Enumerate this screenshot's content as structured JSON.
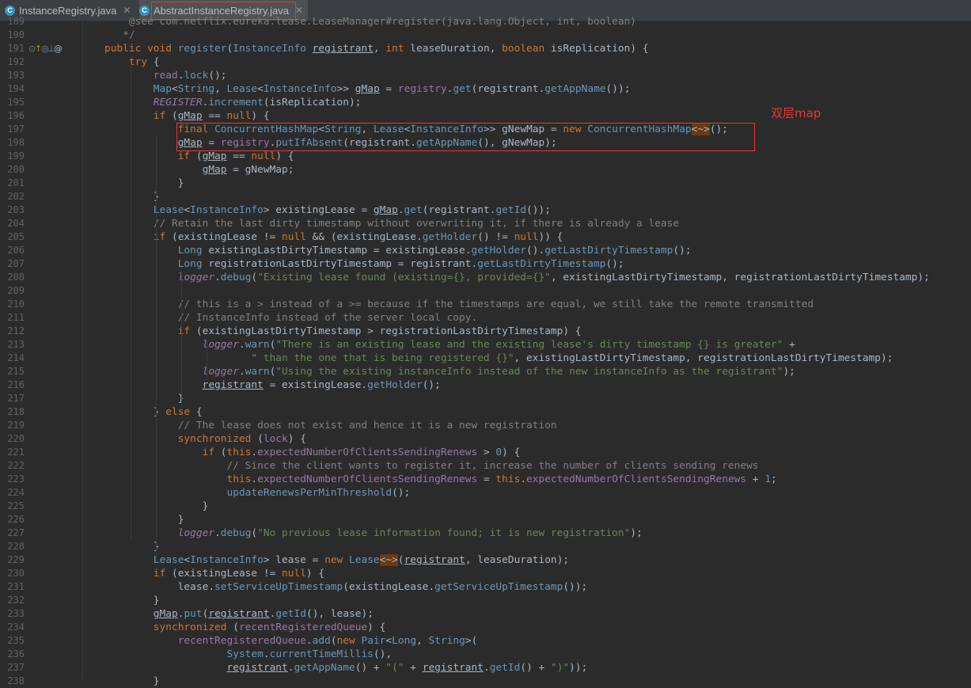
{
  "tabs": [
    {
      "name": "InstanceRegistry.java",
      "icon": "java-class-icon",
      "active": false
    },
    {
      "name": "AbstractInstanceRegistry.java",
      "icon": "java-class-icon",
      "active": true
    }
  ],
  "annotation": "双层map",
  "colors": {
    "keyword": "#cc7832",
    "string": "#6a8759",
    "comment": "#808080",
    "field": "#9876aa",
    "method": "#6897bb",
    "annotation_red": "#e53935"
  },
  "lines": [
    {
      "n": "189",
      "html": "    <span class=\"c\">@see com.netflix.eureka.lease.LeaseManager#register(java.lang.Object, int, boolean)</span>"
    },
    {
      "n": "190",
      "html": "   <span class=\"c\">*/</span>"
    },
    {
      "n": "191",
      "html": "<span class=\"k\">public void</span> <span class=\"mt\">register</span>(<span class=\"t\">InstanceInfo</span> <span class=\"u\">registrant</span>, <span class=\"k\">int</span> leaseDuration, <span class=\"k\">boolean</span> isReplication) {"
    },
    {
      "n": "192",
      "html": "    <span class=\"k\">try</span> {"
    },
    {
      "n": "193",
      "html": "        <span class=\"f\">read</span>.<span class=\"mt\">lock</span>();"
    },
    {
      "n": "194",
      "html": "        <span class=\"t\">Map</span>&lt;<span class=\"t\">String</span>, <span class=\"t\">Lease</span>&lt;<span class=\"t\">InstanceInfo</span>&gt;&gt; <span class=\"u\">gMap</span> = <span class=\"f\">registry</span>.<span class=\"mt\">get</span>(registrant.<span class=\"mt\">getAppName</span>());"
    },
    {
      "n": "195",
      "html": "        <span class=\"sf\">REGISTER</span>.<span class=\"mt\">increment</span>(isReplication);"
    },
    {
      "n": "196",
      "html": "        <span class=\"k\">if</span> (<span class=\"u\">gMap</span> == <span class=\"k\">null</span>) {"
    },
    {
      "n": "197",
      "html": "            <span class=\"k\">final</span> <span class=\"t\">ConcurrentHashMap</span>&lt;<span class=\"t\">String</span>, <span class=\"t\">Lease</span>&lt;<span class=\"t\">InstanceInfo</span>&gt;&gt; gNewMap = <span class=\"k\">new</span> <span class=\"t\">ConcurrentHashMap</span><span class=\"hl\">&lt;~&gt;</span>();"
    },
    {
      "n": "198",
      "html": "            <span class=\"u\">gMap</span> = <span class=\"f\">registry</span>.<span class=\"mt\">putIfAbsent</span>(registrant.<span class=\"mt\">getAppName</span>(), gNewMap);"
    },
    {
      "n": "199",
      "html": "            <span class=\"k\">if</span> (<span class=\"u\">gMap</span> == <span class=\"k\">null</span>) {"
    },
    {
      "n": "200",
      "html": "                <span class=\"u\">gMap</span> = gNewMap;"
    },
    {
      "n": "201",
      "html": "            }"
    },
    {
      "n": "202",
      "html": "        }"
    },
    {
      "n": "203",
      "html": "        <span class=\"t\">Lease</span>&lt;<span class=\"t\">InstanceInfo</span>&gt; existingLease = <span class=\"u\">gMap</span>.<span class=\"mt\">get</span>(registrant.<span class=\"mt\">getId</span>());"
    },
    {
      "n": "204",
      "html": "        <span class=\"c\">// Retain the last dirty timestamp without overwriting it, if there is already a lease</span>"
    },
    {
      "n": "205",
      "html": "        <span class=\"k\">if</span> (existingLease != <span class=\"k\">null</span> &amp;&amp; (existingLease.<span class=\"mt\">getHolder</span>() != <span class=\"k\">null</span>)) {"
    },
    {
      "n": "206",
      "html": "            <span class=\"t\">Long</span> existingLastDirtyTimestamp = existingLease.<span class=\"mt\">getHolder</span>().<span class=\"mt\">getLastDirtyTimestamp</span>();"
    },
    {
      "n": "207",
      "html": "            <span class=\"t\">Long</span> registrationLastDirtyTimestamp = registrant.<span class=\"mt\">getLastDirtyTimestamp</span>();"
    },
    {
      "n": "208",
      "html": "            <span class=\"sf\">logger</span>.<span class=\"mt\">debug</span>(<span class=\"s\">\"Existing lease found (existing={}, provided={}\"</span>, existingLastDirtyTimestamp, registrationLastDirtyTimestamp);"
    },
    {
      "n": "209",
      "html": ""
    },
    {
      "n": "210",
      "html": "            <span class=\"c\">// this is a &gt; instead of a &gt;= because if the timestamps are equal, we still take the remote transmitted</span>"
    },
    {
      "n": "211",
      "html": "            <span class=\"c\">// InstanceInfo instead of the server local copy.</span>"
    },
    {
      "n": "212",
      "html": "            <span class=\"k\">if</span> (existingLastDirtyTimestamp &gt; registrationLastDirtyTimestamp) {"
    },
    {
      "n": "213",
      "html": "                <span class=\"sf\">logger</span>.<span class=\"mt\">warn</span>(<span class=\"s\">\"There is an existing lease and the existing lease's dirty timestamp {} is greater\"</span> +"
    },
    {
      "n": "214",
      "html": "                        <span class=\"s\">\" than the one that is being registered {}\"</span>, existingLastDirtyTimestamp, registrationLastDirtyTimestamp);"
    },
    {
      "n": "215",
      "html": "                <span class=\"sf\">logger</span>.<span class=\"mt\">warn</span>(<span class=\"s\">\"Using the existing instanceInfo instead of the new instanceInfo as the registrant\"</span>);"
    },
    {
      "n": "216",
      "html": "                <span class=\"u\">registrant</span> = existingLease.<span class=\"mt\">getHolder</span>();"
    },
    {
      "n": "217",
      "html": "            }"
    },
    {
      "n": "218",
      "html": "        } <span class=\"k\">else</span> {"
    },
    {
      "n": "219",
      "html": "            <span class=\"c\">// The lease does not exist and hence it is a new registration</span>"
    },
    {
      "n": "220",
      "html": "            <span class=\"k\">synchronized</span> (<span class=\"f\">lock</span>) {"
    },
    {
      "n": "221",
      "html": "                <span class=\"k\">if</span> (<span class=\"k\">this</span>.<span class=\"f\">expectedNumberOfClientsSendingRenews</span> &gt; <span class=\"n\">0</span>) {"
    },
    {
      "n": "222",
      "html": "                    <span class=\"c\">// Since the client wants to register it, increase the number of clients sending renews</span>"
    },
    {
      "n": "223",
      "html": "                    <span class=\"k\">this</span>.<span class=\"f\">expectedNumberOfClientsSendingRenews</span> = <span class=\"k\">this</span>.<span class=\"f\">expectedNumberOfClientsSendingRenews</span> + <span class=\"n\">1</span>;"
    },
    {
      "n": "224",
      "html": "                    <span class=\"mt\">updateRenewsPerMinThreshold</span>();"
    },
    {
      "n": "225",
      "html": "                }"
    },
    {
      "n": "226",
      "html": "            }"
    },
    {
      "n": "227",
      "html": "            <span class=\"sf\">logger</span>.<span class=\"mt\">debug</span>(<span class=\"s\">\"No previous lease information found; it is new registration\"</span>);"
    },
    {
      "n": "228",
      "html": "        }"
    },
    {
      "n": "229",
      "html": "        <span class=\"t\">Lease</span>&lt;<span class=\"t\">InstanceInfo</span>&gt; lease = <span class=\"k\">new</span> <span class=\"t\">Lease</span><span class=\"hl\">&lt;~&gt;</span>(<span class=\"u\">registrant</span>, leaseDuration);"
    },
    {
      "n": "230",
      "html": "        <span class=\"k\">if</span> (existingLease != <span class=\"k\">null</span>) {"
    },
    {
      "n": "231",
      "html": "            lease.<span class=\"mt\">setServiceUpTimestamp</span>(existingLease.<span class=\"mt\">getServiceUpTimestamp</span>());"
    },
    {
      "n": "232",
      "html": "        }"
    },
    {
      "n": "233",
      "html": "        <span class=\"u\">gMap</span>.<span class=\"mt\">put</span>(<span class=\"u\">registrant</span>.<span class=\"mt\">getId</span>(), lease);"
    },
    {
      "n": "234",
      "html": "        <span class=\"k\">synchronized</span> (<span class=\"f\">recentRegisteredQueue</span>) {"
    },
    {
      "n": "235",
      "html": "            <span class=\"f\">recentRegisteredQueue</span>.<span class=\"mt\">add</span>(<span class=\"k\">new</span> <span class=\"t\">Pair</span>&lt;<span class=\"t\">Long</span>, <span class=\"t\">String</span>&gt;("
    },
    {
      "n": "236",
      "html": "                    <span class=\"t\">System</span>.<span class=\"mt\">currentTimeMillis</span>(),"
    },
    {
      "n": "237",
      "html": "                    <span class=\"u\">registrant</span>.<span class=\"mt\">getAppName</span>() + <span class=\"s\">\"(\"</span> + <span class=\"u\">registrant</span>.<span class=\"mt\">getId</span>() + <span class=\"s\">\")\"</span>));"
    },
    {
      "n": "238",
      "html": "        }"
    }
  ]
}
